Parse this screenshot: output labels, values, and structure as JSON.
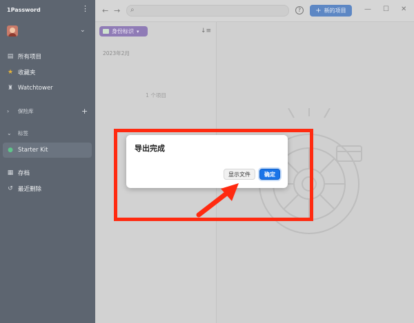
{
  "app": {
    "title": "1Password"
  },
  "sidebar": {
    "items": [
      {
        "label": "所有项目",
        "icon": "all-items-icon"
      },
      {
        "label": "收藏夹",
        "icon": "star-icon"
      },
      {
        "label": "Watchtower",
        "icon": "watchtower-icon"
      }
    ],
    "vaults_label": "保险库",
    "tags_label": "标签",
    "tag_item": "Starter Kit",
    "archive_label": "存档",
    "recently_deleted_label": "最近删除"
  },
  "toolbar": {
    "search_placeholder": "",
    "new_item_label": "新的项目"
  },
  "list": {
    "filter_chip": "身份标识",
    "month": "2023年2月",
    "count": "1 个项目"
  },
  "dialog": {
    "title": "导出完成",
    "show_file_label": "显示文件",
    "ok_label": "确定"
  },
  "colors": {
    "sidebar_bg": "#5d6570",
    "primary_button": "#1a74e8",
    "annotation_red": "#ff2a10",
    "chip": "#8f7bb6"
  }
}
